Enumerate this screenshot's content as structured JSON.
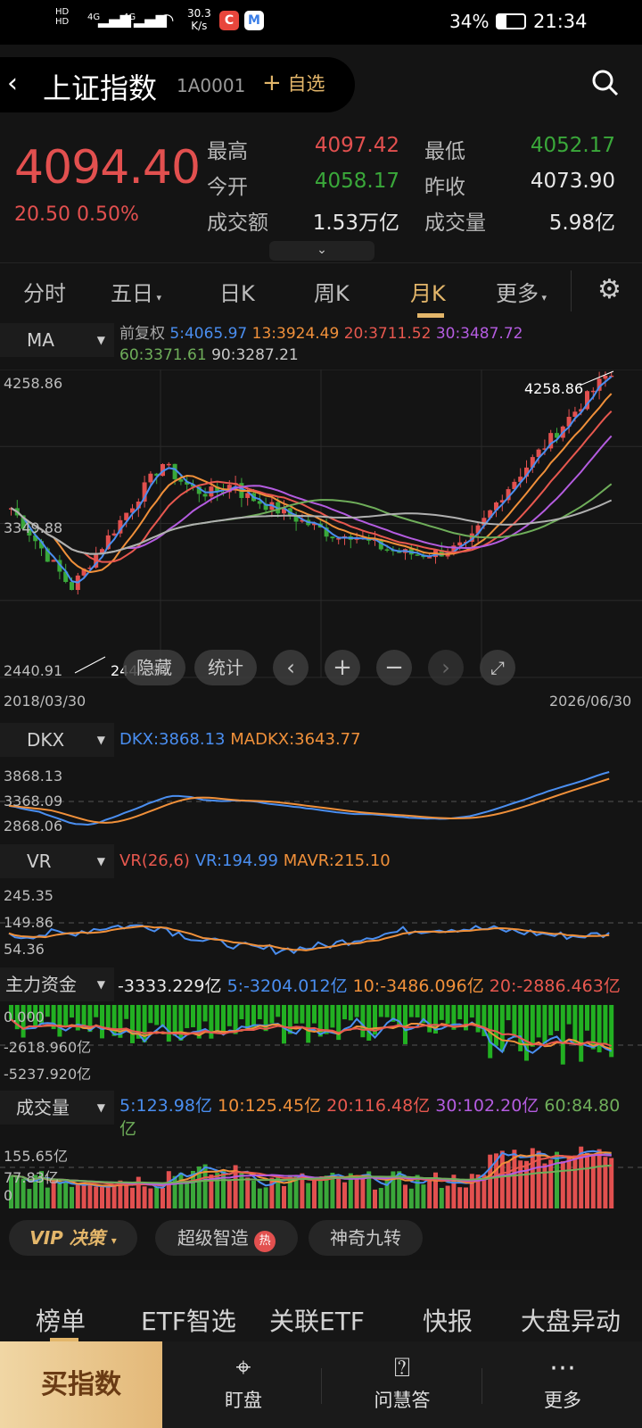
{
  "status": {
    "hd1": "HD",
    "hd2": "HD",
    "net": "4G",
    "speed": "30.3",
    "speed_unit": "K/s",
    "battery": "34%",
    "time": "21:34"
  },
  "header": {
    "title": "上证指数",
    "code": "1A0001",
    "add_fav": "自选"
  },
  "quote": {
    "price": "4094.40",
    "change": "20.50",
    "change_pct": "0.50%",
    "high_label": "最高",
    "high": "4097.42",
    "low_label": "最低",
    "low": "4052.17",
    "open_label": "今开",
    "open": "4058.17",
    "prev_label": "昨收",
    "prev": "4073.90",
    "amount_label": "成交额",
    "amount": "1.53万亿",
    "volume_label": "成交量",
    "volume": "5.98亿"
  },
  "tabs": [
    "分时",
    "五日",
    "日K",
    "周K",
    "月K",
    "更多"
  ],
  "active_tab": "月K",
  "ma": {
    "selector": "MA",
    "adjust": "前复权",
    "ma5": "5:4065.97",
    "ma13": "13:3924.49",
    "ma20": "20:3711.52",
    "ma30": "30:3487.72",
    "ma60": "60:3371.61",
    "ma90": "90:3287.21",
    "y_top": "4258.86",
    "y_mid": "3349.88",
    "y_bot": "2440.91",
    "high_tag": "4258.86",
    "low_tag": "2440.91",
    "date_start": "2018/03/30",
    "date_end": "2026/06/30",
    "btn_hide": "隐藏",
    "btn_stats": "统计"
  },
  "dkx": {
    "selector": "DKX",
    "dkx": "DKX:3868.13",
    "madkx": "MADKX:3643.77",
    "y_top": "3868.13",
    "y_mid": "3368.09",
    "y_bot": "2868.06"
  },
  "vr": {
    "selector": "VR",
    "params": "VR(26,6)",
    "vr": "VR:194.99",
    "mavr": "MAVR:215.10",
    "y_top": "245.35",
    "y_mid": "149.86",
    "y_bot": "54.36"
  },
  "fund": {
    "selector": "主力资金",
    "val": "-3333.229亿",
    "m5": "5:-3204.012亿",
    "m10": "10:-3486.096亿",
    "m20": "20:-2886.463亿",
    "y_top": "0.000",
    "y_mid": "-2618.960亿",
    "y_bot": "-5237.920亿"
  },
  "vol": {
    "selector": "成交量",
    "m5": "5:123.98亿",
    "m10": "10:125.45亿",
    "m20": "20:116.48亿",
    "m30": "30:102.20亿",
    "m60": "60:84.80",
    "m60b": "亿",
    "y_top": "155.65亿",
    "y_mid": "77.83亿",
    "y_bot": "0"
  },
  "tools": {
    "vip": "VIP 决策",
    "smart": "超级智造",
    "hot": "热",
    "nine": "神奇九转"
  },
  "bottom_tabs": [
    "榜单",
    "ETF智选",
    "关联ETF",
    "快报",
    "大盘异动"
  ],
  "nav": {
    "buy": "买指数",
    "watch": "盯盘",
    "ask": "问慧答",
    "more": "更多"
  },
  "colors": {
    "up": "#e2504f",
    "down": "#3aa83a",
    "ma5": "#4a8ef0",
    "ma13": "#f0903a",
    "ma20": "#e8584f",
    "ma30": "#b45ce0",
    "ma60": "#6fae5a",
    "ma90": "#b0b0b0",
    "accent": "#e3b66a"
  }
}
